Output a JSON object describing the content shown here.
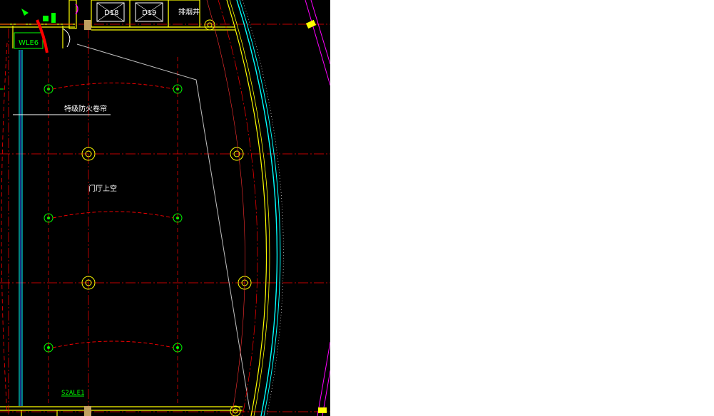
{
  "drawing": {
    "background": "#000000",
    "colors": {
      "yellow": "#ffff00",
      "green": "#00ff00",
      "cyan": "#00ffff",
      "red": "#ff0000",
      "magenta": "#ff00ff",
      "white": "#ffffff",
      "gray": "#c0c0c0"
    },
    "labels": {
      "elevator_1": "D18",
      "elevator_2": "D19",
      "smoke_shaft": "排烟井",
      "fire_shutter": "特级防火卷帘",
      "hall_void": "门厅上空",
      "tag_top": "WLE6",
      "tag_bottom": "S2ALE1"
    }
  }
}
